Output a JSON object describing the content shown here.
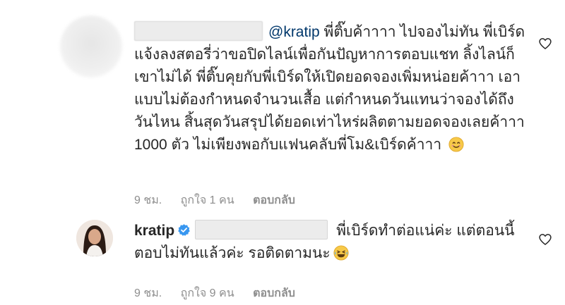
{
  "comment1": {
    "mention": "@kratip",
    "text": "พี่ติ๊บค้าาาา ไปจองไม่ทัน พี่เบิร์ดแจ้งลงสตอรี่ว่าขอปิดไลน์เพื่อกันปัญหาการตอบแชท ลิ้งไลน์ก็เขาไม่ได้ พี่ติ๊บคุยกับพี่เบิร์ดให้เปิดยอดจองเพิ่มหน่อยค้าาา เอาแบบไม่ต้องกำหนดจำนวนเสื้อ แต่กำหนดวันแทนว่าจองได้ถึงวันไหน สิ้นสุดวันสรุปได้ยอดเท่าไหร่ผลิตตามยอดจองเลยค้าาา 1000 ตัว ไม่เพียงพอกับแฟนคลับพี่โม&เบิร์ดค้าาา",
    "emoji": "smiling-face-icon",
    "meta": {
      "time": "9 ชม.",
      "likes": "ถูกใจ 1 คน",
      "reply": "ตอบกลับ"
    }
  },
  "comment2": {
    "username": "kratip",
    "text": "พี่เบิร์ดทำต่อแน่ค่ะ แต่ตอนนี้ตอบไม่ทันแล้วค่ะ รอติดตามนะ",
    "emoji": "laughing-tears-icon",
    "meta": {
      "time": "9 ชม.",
      "likes": "ถูกใจ 9 คน",
      "reply": "ตอบกลับ"
    }
  },
  "colors": {
    "mention": "#00376b",
    "verified": "#3897f0",
    "meta": "#8e8e8e",
    "text": "#262626"
  }
}
